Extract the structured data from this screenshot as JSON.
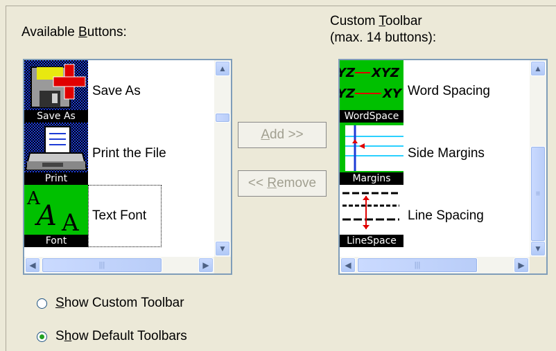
{
  "available": {
    "label_pre": "Available ",
    "label_key": "B",
    "label_post": "uttons:",
    "items": [
      {
        "caption": "Save As",
        "text": "Save As",
        "icon": "save-as-icon"
      },
      {
        "caption": "Print",
        "text": "Print the File",
        "icon": "printer-icon"
      },
      {
        "caption": "Font",
        "text": "Text Font",
        "icon": "font-icon"
      }
    ]
  },
  "custom": {
    "label_line1_pre": "Custom ",
    "label_key": "T",
    "label_line1_post": "oolbar",
    "label_line2": "(max. 14 buttons):",
    "items": [
      {
        "caption": "WordSpace",
        "text": "Word Spacing",
        "icon": "word-spacing-icon"
      },
      {
        "caption": "Margins",
        "text": "Side Margins",
        "icon": "margins-icon"
      },
      {
        "caption": "LineSpace",
        "text": "Line Spacing",
        "icon": "line-spacing-icon"
      }
    ]
  },
  "buttons": {
    "add_key": "A",
    "add_rest": "dd >>",
    "remove_pre": "<< ",
    "remove_key": "R",
    "remove_rest": "emove"
  },
  "options": {
    "custom_key": "S",
    "custom_rest": "how Custom Toolbar",
    "default_pre": "S",
    "default_key": "h",
    "default_rest": "ow Default Toolbars",
    "selected": "default"
  },
  "glyphs": {
    "up": "▲",
    "down": "▼",
    "left": "◀",
    "right": "▶",
    "grip_h": "|||",
    "grip_v": "≡"
  }
}
